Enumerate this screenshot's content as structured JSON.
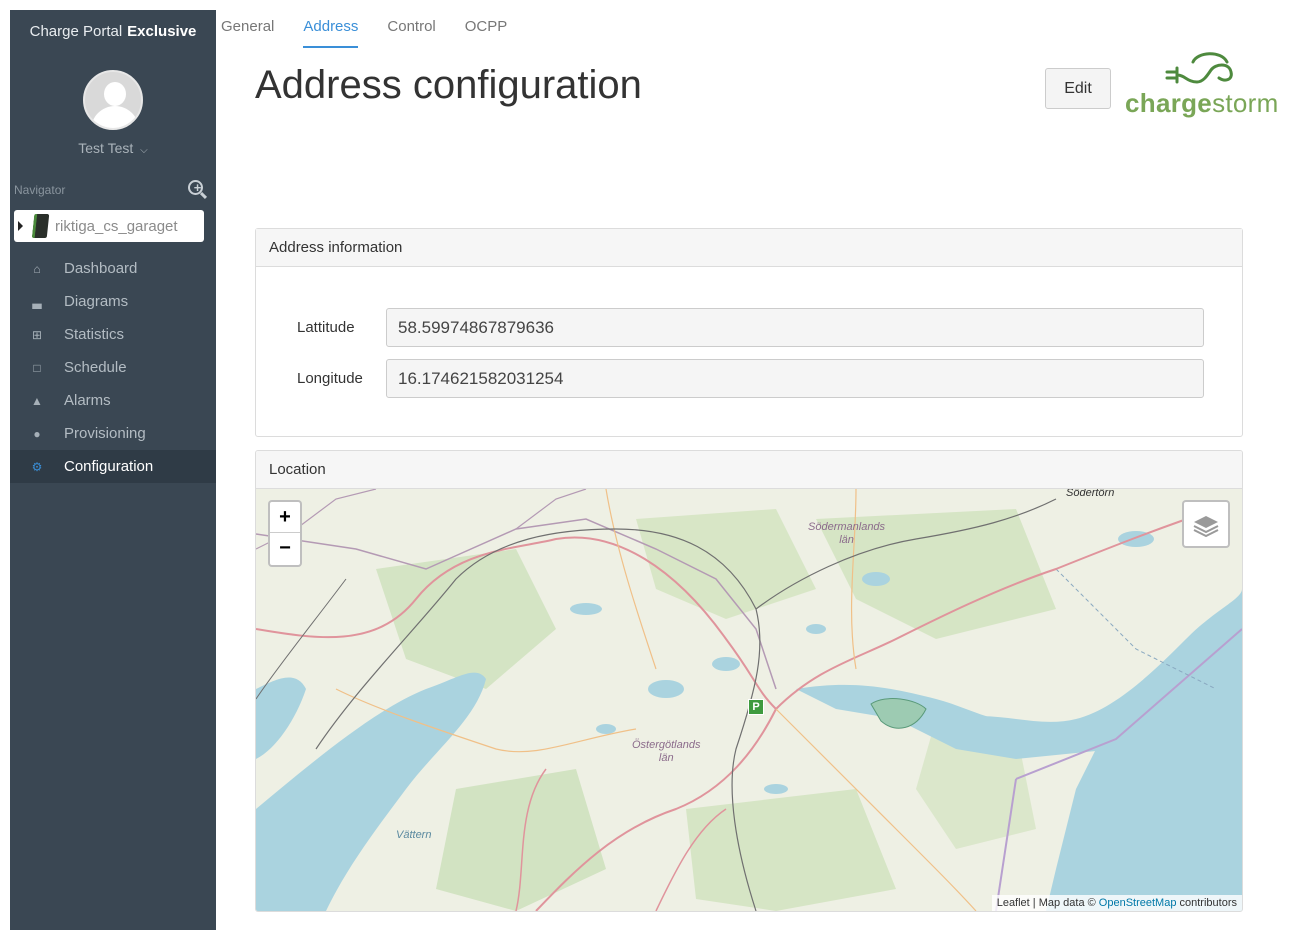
{
  "sidebar": {
    "brand_prefix": "Charge Portal",
    "brand_bold": "Exclusive",
    "user_name": "Test Test",
    "user_chevron": "⌵",
    "navigator_label": "Navigator",
    "device_name": "riktiga_cs_garaget",
    "items": [
      {
        "label": "Dashboard",
        "icon": "home-icon"
      },
      {
        "label": "Diagrams",
        "icon": "bar-chart-icon"
      },
      {
        "label": "Statistics",
        "icon": "table-icon"
      },
      {
        "label": "Schedule",
        "icon": "calendar-icon"
      },
      {
        "label": "Alarms",
        "icon": "warning-icon"
      },
      {
        "label": "Provisioning",
        "icon": "users-icon"
      },
      {
        "label": "Configuration",
        "icon": "gear-icon",
        "active": true
      }
    ]
  },
  "tabs": [
    {
      "label": "General"
    },
    {
      "label": "Address",
      "active": true
    },
    {
      "label": "Control"
    },
    {
      "label": "OCPP"
    }
  ],
  "page": {
    "title": "Address configuration",
    "edit_label": "Edit",
    "logo_part1": "charge",
    "logo_part2": "storm"
  },
  "address": {
    "panel_title": "Address information",
    "latitude_label": "Lattitude",
    "latitude_value": "58.59974867879636",
    "longitude_label": "Longitude",
    "longitude_value": "16.174621582031254"
  },
  "location": {
    "panel_title": "Location",
    "zoom_in": "+",
    "zoom_out": "−",
    "marker_label": "P",
    "labels": {
      "sodermanland_1": "Södermanlands",
      "sodermanland_2": "län",
      "ostergotland_1": "Östergötlands",
      "ostergotland_2": "län",
      "vattern": "Vättern",
      "sodertorn": "Södertörn"
    },
    "attribution_prefix": "Leaflet | Map data ©",
    "attribution_link": "OpenStreetMap",
    "attribution_suffix": "contributors"
  },
  "colors": {
    "sidebar_bg": "#3a4753",
    "accent": "#3a8fd8",
    "logo_green": "#4e8a3e",
    "water": "#aad3df"
  }
}
